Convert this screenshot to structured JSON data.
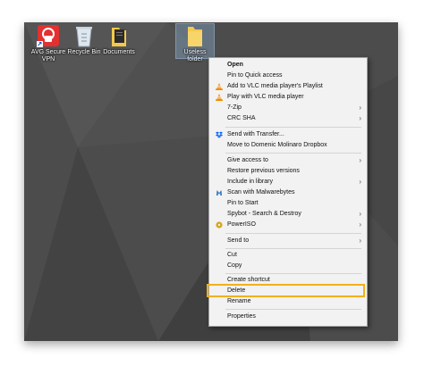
{
  "desktop": {
    "icons": [
      {
        "name": "avg-secure-vpn",
        "label": "AVG Secure VPN"
      },
      {
        "name": "recycle-bin",
        "label": "Recycle Bin"
      },
      {
        "name": "documents",
        "label": "Documents"
      },
      {
        "name": "useless-folder",
        "label": "Useless folder"
      }
    ]
  },
  "context_menu": {
    "items": [
      {
        "label": "Open"
      },
      {
        "label": "Pin to Quick access"
      },
      {
        "label": "Add to VLC media player's Playlist",
        "icon": "vlc-cone-icon"
      },
      {
        "label": "Play with VLC media player",
        "icon": "vlc-cone-icon"
      },
      {
        "label": "7-Zip"
      },
      {
        "label": "CRC SHA"
      },
      {
        "label": "Send with Transfer...",
        "icon": "dropbox-icon"
      },
      {
        "label": "Move to Domenic Molinaro Dropbox"
      },
      {
        "label": "Give access to"
      },
      {
        "label": "Restore previous versions"
      },
      {
        "label": "Include in library"
      },
      {
        "label": "Scan with Malwarebytes",
        "icon": "malwarebytes-icon"
      },
      {
        "label": "Pin to Start"
      },
      {
        "label": "Spybot - Search & Destroy"
      },
      {
        "label": "PowerISO",
        "icon": "poweriso-icon"
      },
      {
        "label": "Send to"
      },
      {
        "label": "Cut"
      },
      {
        "label": "Copy"
      },
      {
        "label": "Create shortcut"
      },
      {
        "label": "Delete"
      },
      {
        "label": "Rename"
      },
      {
        "label": "Properties"
      }
    ],
    "submenu_arrow": "›"
  },
  "colors": {
    "highlight_border": "#f3b01b",
    "desktop_bg": "#4c4c4c",
    "menu_bg": "#f2f2f2"
  }
}
